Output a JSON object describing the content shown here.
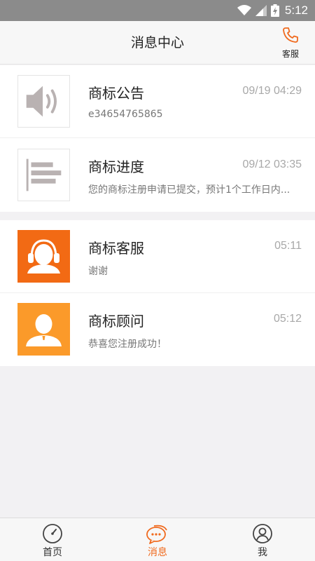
{
  "status_bar": {
    "time": "5:12"
  },
  "header": {
    "title": "消息中心",
    "service_label": "客服"
  },
  "messages": [
    {
      "name": "商标公告",
      "time": "09/19 04:29",
      "preview": "e34654765865",
      "icon": "speaker-icon"
    },
    {
      "name": "商标进度",
      "time": "09/12 03:35",
      "preview": "您的商标注册申请已提交，预计1个工作日内...",
      "icon": "progress-bars-icon"
    },
    {
      "name": "商标客服",
      "time": "05:11",
      "preview": "谢谢",
      "icon": "headset-agent-icon"
    },
    {
      "name": "商标顾问",
      "time": "05:12",
      "preview": "恭喜您注册成功！",
      "icon": "consultant-person-icon"
    }
  ],
  "tabs": [
    {
      "label": "首页",
      "icon": "compass-icon"
    },
    {
      "label": "消息",
      "icon": "chat-bubble-icon",
      "active": true
    },
    {
      "label": "我",
      "icon": "user-circle-icon"
    }
  ],
  "colors": {
    "accent": "#f06a1e",
    "customer_service": "#f26a14",
    "consultant": "#fb9a2a",
    "status_bar": "#8b8b8b"
  }
}
